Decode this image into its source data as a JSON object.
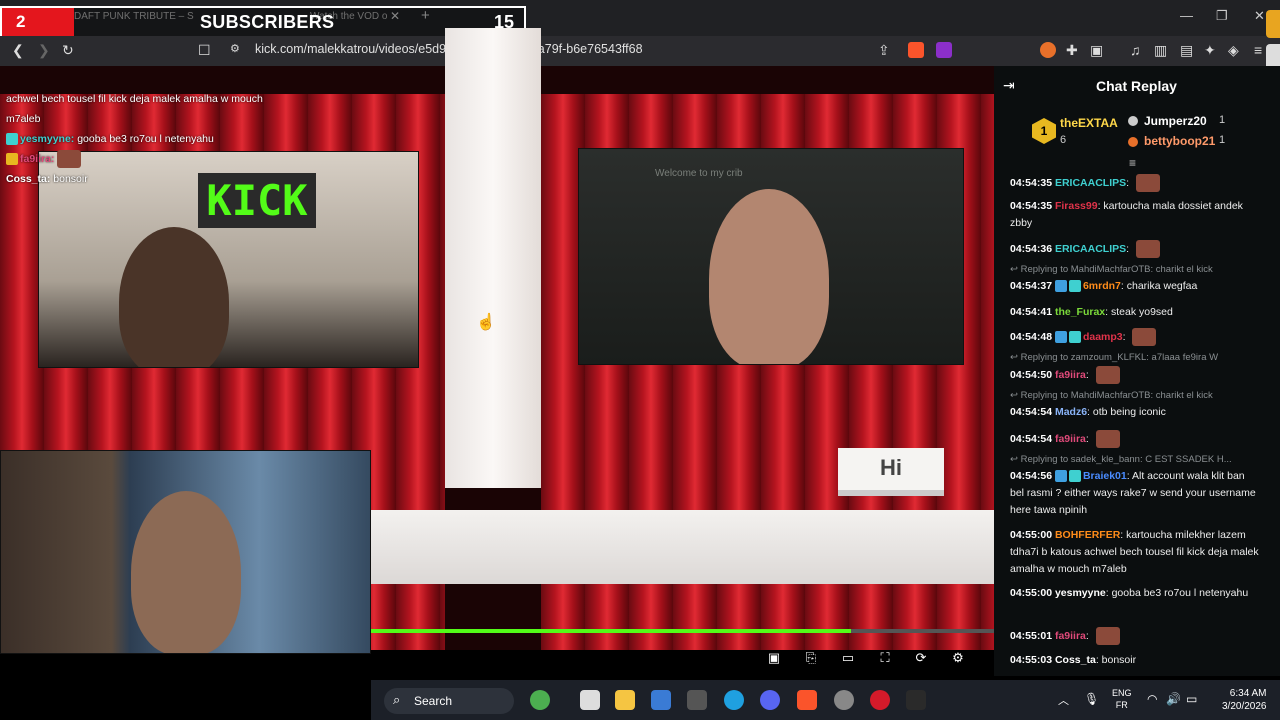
{
  "browser": {
    "tab_title": "DAFT PUNK TRIBUTE – Sun",
    "tab2_title": "Watch the VOD o",
    "url": "kick.com/malekkatrou/videos/e5d94d9c-0faa-41d3-a79f-b6e76543ff68"
  },
  "overlay": {
    "count": "2",
    "title": "SUBSCRIBERS",
    "total": "15"
  },
  "video": {
    "sign": "Hi",
    "wall_text": "KICK",
    "welcome_text": "Welcome to my crib",
    "progress": 0.77,
    "chat": [
      {
        "user": "",
        "text": "achwel bech tousel fil kick deja malek amalha w mouch m7aleb",
        "color": "#ffffff"
      },
      {
        "user": "yesmyyne:",
        "text": " gooba be3 ro7ou l netenyahu",
        "color": "#ffffff"
      },
      {
        "user": "fa9iira:",
        "text": "",
        "color": "#ffffff"
      },
      {
        "user": "Coss_ta:",
        "text": " bonsoir",
        "color": "#ffffff"
      }
    ]
  },
  "chat": {
    "title": "Chat Replay",
    "leaderboard": [
      {
        "rank": "1",
        "name": "theEXTAA",
        "count": "6"
      },
      {
        "rank": "",
        "name": "Jumperz20",
        "count": "1"
      },
      {
        "rank": "",
        "name": "bettyboop21",
        "count": "1"
      }
    ],
    "messages": [
      {
        "time": "04:54:35",
        "user": "ERICAACLIPS",
        "text": "",
        "color": "#3fd0d0"
      },
      {
        "time": "04:54:35",
        "user": "Firass99",
        "text": "kartoucha mala dossiet andek zbby",
        "color": "#e0334a"
      },
      {
        "time": "04:54:36",
        "user": "ERICAACLIPS",
        "text": "",
        "color": "#3fd0d0"
      },
      {
        "time": "04:54:37",
        "user": "6mrdn7",
        "text": "charika wegfaa",
        "color": "#ff8c1a",
        "reply": "Replying to MahdiMachfarOTB: charikt el kick"
      },
      {
        "time": "04:54:41",
        "user": "the_Furax",
        "text": "steak yo9sed",
        "color": "#7cdb3a"
      },
      {
        "time": "04:54:48",
        "user": "daamp3",
        "text": "",
        "color": "#e0334a"
      },
      {
        "time": "04:54:50",
        "user": "fa9iira",
        "text": "",
        "color": "#e04a7a",
        "reply": "Replying to zamzoum_KLFKL: a7laaa fe9ira W"
      },
      {
        "time": "04:54:54",
        "user": "Madz6",
        "text": "otb being iconic",
        "color": "#8ab4f8",
        "reply": "Replying to MahdiMachfarOTB: charikt el kick"
      },
      {
        "time": "04:54:54",
        "user": "fa9iira",
        "text": "",
        "color": "#e04a7a"
      },
      {
        "time": "04:54:56",
        "user": "Braiek01",
        "text": "Alt account wala klit ban bel rasmi ? either ways rake7 w send your username here tawa npinih",
        "color": "#4a8cff",
        "reply": "Replying to sadek_kle_bann: C EST SSADEK H..."
      },
      {
        "time": "04:55:00",
        "user": "BOHFERFER",
        "text": "kartoucha milekher lazem tdha7i b katous achwel bech tousel fil kick deja malek amalha w mouch m7aleb",
        "color": "#ff8c1a"
      },
      {
        "time": "04:55:00",
        "user": "yesmyyne",
        "text": "gooba be3 ro7ou l netenyahu",
        "color": "#ffffff"
      },
      {
        "time": "04:55:01",
        "user": "fa9iira",
        "text": "",
        "color": "#e04a7a"
      },
      {
        "time": "04:55:03",
        "user": "Coss_ta",
        "text": "bonsoir",
        "color": "#ffffff"
      }
    ]
  },
  "taskbar": {
    "search": "Search",
    "lang1": "ENG",
    "lang2": "FR",
    "time": "6:34 AM",
    "date": "3/20/2026"
  }
}
